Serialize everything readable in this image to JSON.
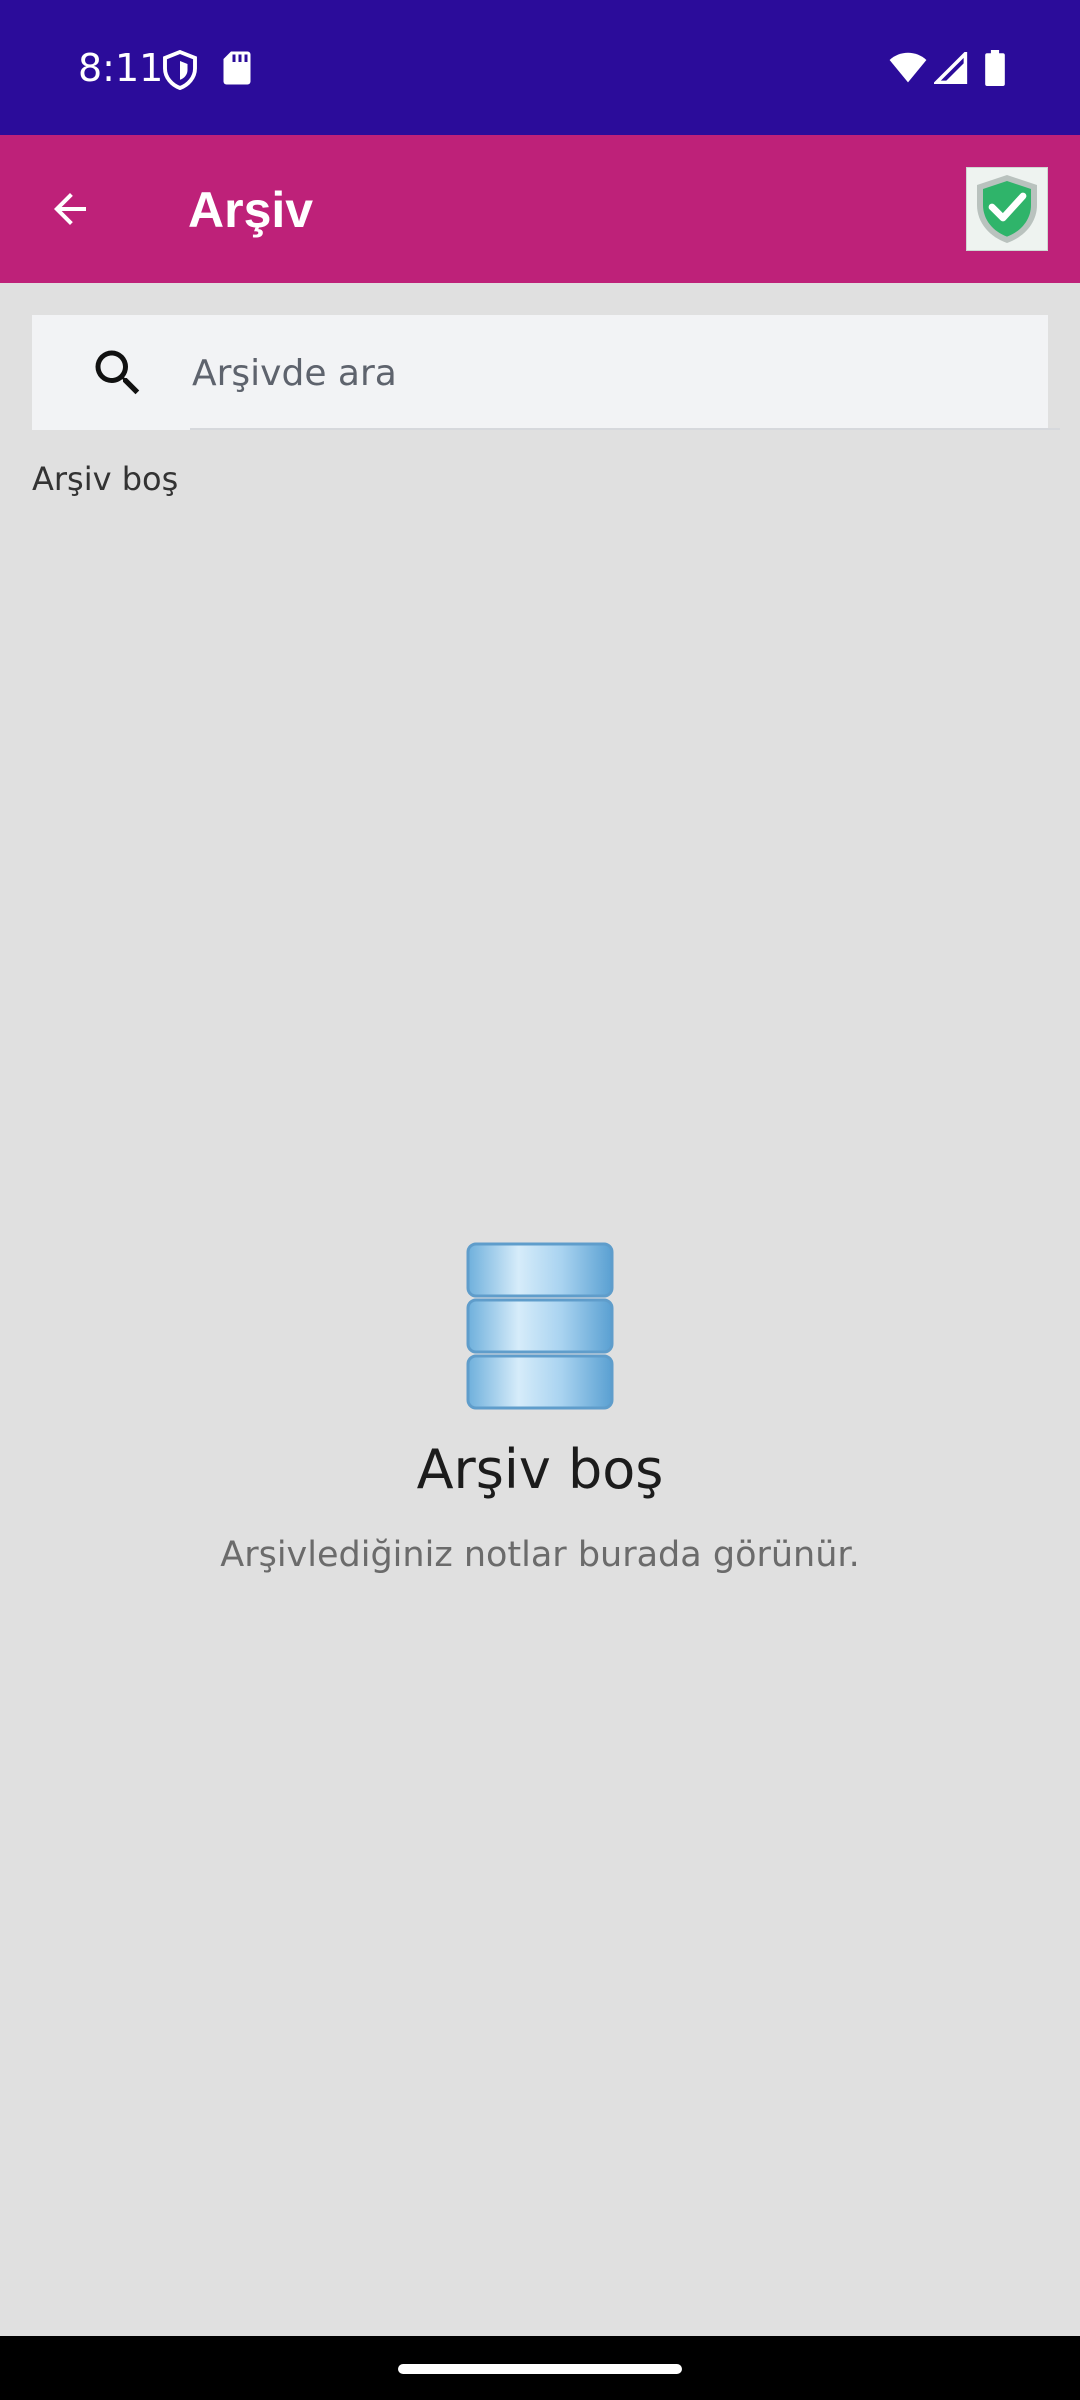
{
  "status_bar": {
    "time": "8:11",
    "icons": [
      "shield-icon",
      "sd-card-icon",
      "wifi-icon",
      "signal-icon",
      "battery-icon"
    ]
  },
  "app_bar": {
    "title": "Arşiv",
    "back_icon": "arrow-left-icon",
    "badge_icon": "shield-check-icon",
    "background": "#be2179"
  },
  "search": {
    "placeholder": "Arşivde ara",
    "value": ""
  },
  "list": {
    "section_label": "Arşiv boş"
  },
  "empty_state": {
    "icon": "database-icon",
    "title": "Arşiv boş",
    "subtitle": "Arşivlediğiniz notlar burada görünür."
  },
  "colors": {
    "status_bar": "#2b0c9a",
    "app_bar": "#be2179",
    "background": "#e0e0e0"
  }
}
